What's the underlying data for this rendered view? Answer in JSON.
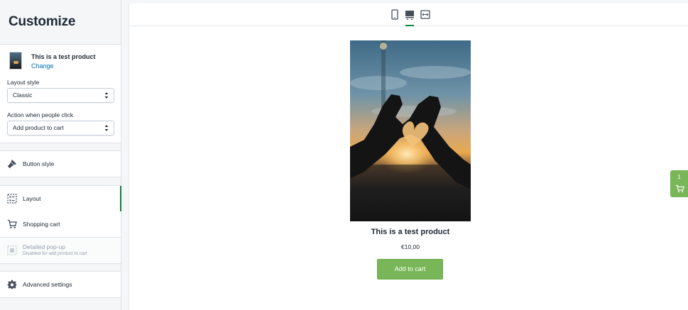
{
  "sidebar": {
    "title": "Customize",
    "product": {
      "name": "This is a test product",
      "change_label": "Change"
    },
    "layout_style": {
      "label": "Layout style",
      "value": "Classic"
    },
    "action_click": {
      "label": "Action when people click",
      "value": "Add product to cart"
    },
    "items": [
      {
        "label": "Button style",
        "icon": "paint-brush-icon"
      },
      {
        "label": "Layout",
        "icon": "layout-icon",
        "active": true
      },
      {
        "label": "Shopping cart",
        "icon": "cart-icon"
      },
      {
        "label": "Detailed pop-up",
        "sub": "Disabled for add product to cart",
        "icon": "popup-icon",
        "disabled": true
      },
      {
        "label": "Advanced settings",
        "icon": "gear-icon"
      }
    ]
  },
  "toolbar": {
    "buttons": [
      "mobile-view-icon",
      "desktop-view-icon",
      "fullwidth-view-icon"
    ],
    "active": "desktop-view-icon"
  },
  "preview": {
    "product_title": "This is a test product",
    "price": "€10,00",
    "add_to_cart_label": "Add to cart",
    "cart_count": "1"
  },
  "colors": {
    "accent_green": "#108043",
    "button_green": "#78b657",
    "link_blue": "#006fbb"
  }
}
